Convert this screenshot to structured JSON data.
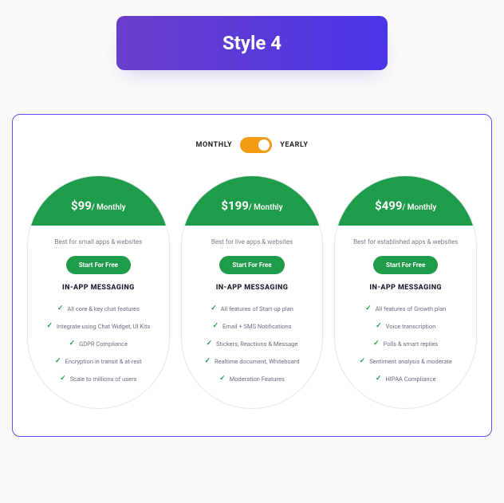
{
  "banner": {
    "title": "Style 4"
  },
  "toggle": {
    "left": "MONTHLY",
    "right": "YEARLY"
  },
  "plans": [
    {
      "price": "$99",
      "period": "/ Monthly",
      "desc": "Best for small apps & websites",
      "cta": "Start For Free",
      "section": "IN-APP MESSAGING",
      "features": [
        "All core & key chat features",
        "Integrate using Chat Widget, UI Kits",
        "GDPR Compliance",
        "Encryption in transit & at-rest",
        "Scale to millions of users"
      ]
    },
    {
      "price": "$199",
      "period": "/ Monthly",
      "desc": "Best for live apps & websites",
      "cta": "Start For Free",
      "section": "IN-APP MESSAGING",
      "features": [
        "All features of Start-up plan",
        "Email + SMS Notifications",
        "Stickers, Reactions & Message",
        "Realtime document, Whiteboard",
        "Moderation Features"
      ]
    },
    {
      "price": "$499",
      "period": "/ Monthly",
      "desc": "Best for established apps & websites",
      "cta": "Start For Free",
      "section": "IN-APP MESSAGING",
      "features": [
        "All features of Growth plan",
        "Voice transcription",
        "Polls & smart replies",
        "Sentiment analysis & moderate",
        "HIPAA Compliance"
      ]
    }
  ]
}
